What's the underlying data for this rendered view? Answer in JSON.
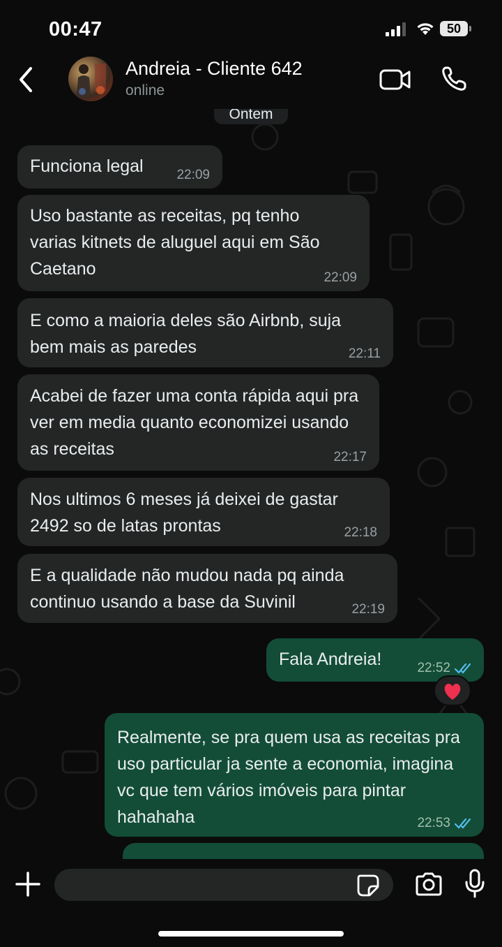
{
  "status_bar": {
    "time": "00:47",
    "battery": "50"
  },
  "header": {
    "contact_name": "Andreia - Cliente 642",
    "contact_status": "online"
  },
  "chat": {
    "date_separator": "Ontem",
    "messages": [
      {
        "direction": "in",
        "text": "Funciona legal",
        "time": "22:09"
      },
      {
        "direction": "in",
        "text": "Uso bastante as receitas, pq tenho varias kitnets de aluguel aqui em São Caetano",
        "time": "22:09"
      },
      {
        "direction": "in",
        "text": "E como a maioria deles são Airbnb, suja bem mais as paredes",
        "time": "22:11"
      },
      {
        "direction": "in",
        "text": "Acabei de fazer uma conta rápida aqui pra ver em media quanto economizei usando as receitas",
        "time": "22:17"
      },
      {
        "direction": "in",
        "text": "Nos ultimos 6 meses já deixei de gastar 2492 so de latas prontas",
        "time": "22:18"
      },
      {
        "direction": "in",
        "text": "E a qualidade não mudou nada pq ainda continuo usando a base da Suvinil",
        "time": "22:19"
      },
      {
        "direction": "out",
        "text": "Fala Andreia!",
        "time": "22:52",
        "reaction": "❤️"
      },
      {
        "direction": "out",
        "text": "Realmente, se pra quem usa as receitas pra uso particular ja sente a economia, imagina vc que tem vários  imóveis para pintar hahahaha",
        "time": "22:53"
      }
    ]
  },
  "input": {
    "placeholder": ""
  },
  "colors": {
    "incoming_bubble": "#242626",
    "outgoing_bubble": "#134d37",
    "read_ticks": "#53bdeb",
    "background": "#0b0b0b"
  }
}
